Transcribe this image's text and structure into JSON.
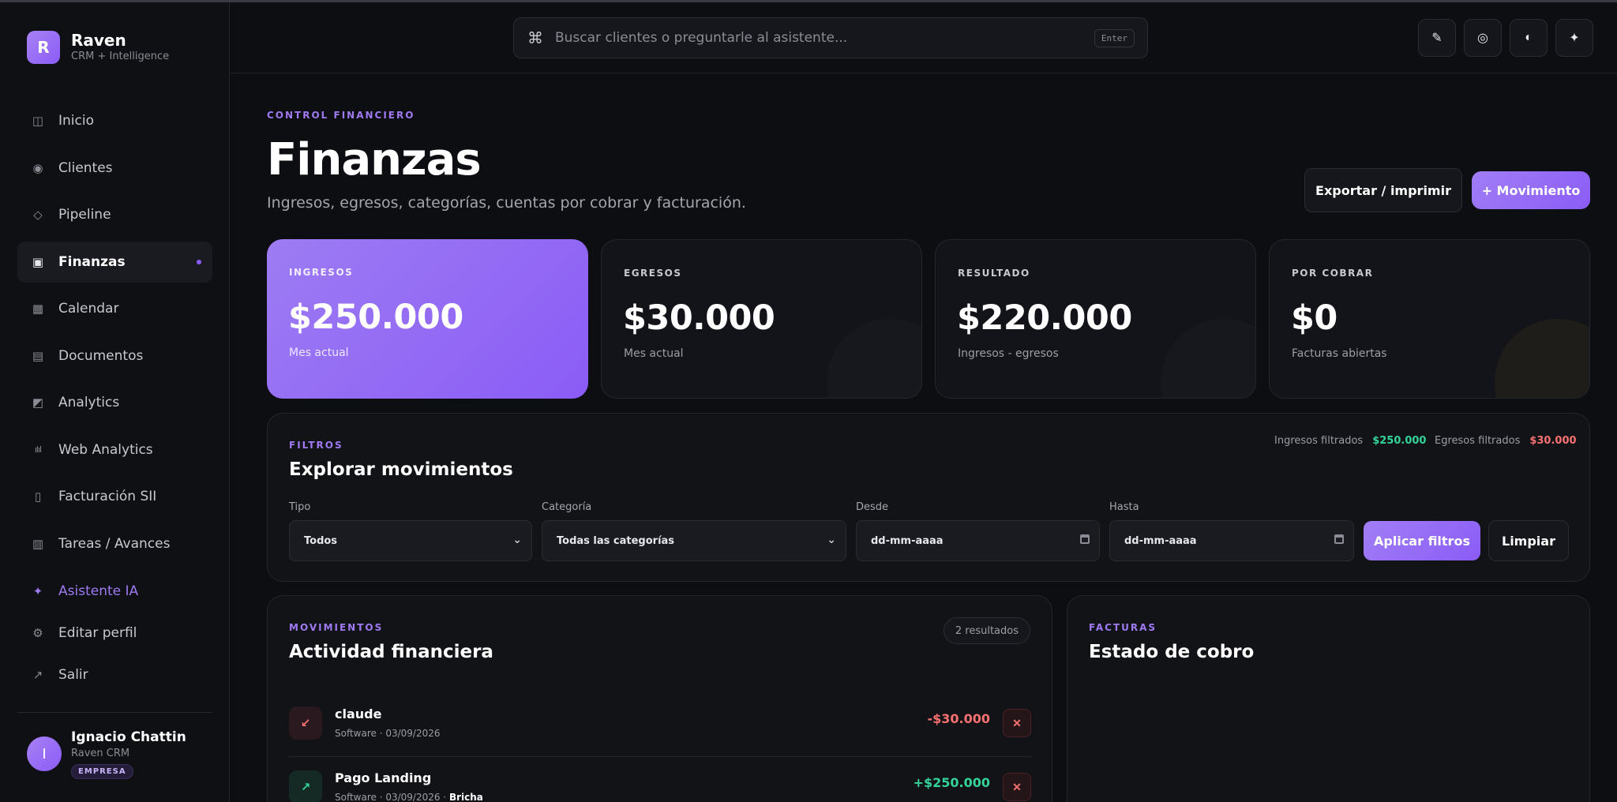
{
  "brand": {
    "initial": "R",
    "name": "Raven",
    "subtitle": "CRM + Intelligence"
  },
  "sidebar": {
    "items": [
      {
        "label": "Inicio",
        "icon": "columns-icon",
        "glyph": "◫"
      },
      {
        "label": "Clientes",
        "icon": "target-icon",
        "glyph": "◉"
      },
      {
        "label": "Pipeline",
        "icon": "diamond-icon",
        "glyph": "◇"
      },
      {
        "label": "Finanzas",
        "icon": "wallet-icon",
        "glyph": "▣",
        "active": true
      },
      {
        "label": "Calendar",
        "icon": "grid-icon",
        "glyph": "▦"
      },
      {
        "label": "Documentos",
        "icon": "stack-icon",
        "glyph": "▤"
      },
      {
        "label": "Analytics",
        "icon": "half-square-icon",
        "glyph": "◩"
      },
      {
        "label": "Web Analytics",
        "icon": "bar-chart-icon",
        "glyph": "ılıl"
      },
      {
        "label": "Facturación SII",
        "icon": "document-icon",
        "glyph": "▯"
      },
      {
        "label": "Tareas / Avances",
        "icon": "tasks-grid-icon",
        "glyph": "▥"
      }
    ],
    "secondary": [
      {
        "label": "Asistente IA",
        "icon": "sparkle-icon",
        "glyph": "✦"
      },
      {
        "label": "Editar perfil",
        "icon": "gear-icon",
        "glyph": "⚙"
      },
      {
        "label": "Salir",
        "icon": "exit-arrow-icon",
        "glyph": "↗"
      }
    ]
  },
  "user": {
    "initial": "I",
    "name": "Ignacio Chattin",
    "org": "Raven CRM",
    "badge": "EMPRESA"
  },
  "search": {
    "icon": "command-icon",
    "glyph": "⌘",
    "placeholder": "Buscar clientes o preguntarle al asistente...",
    "hint": "Enter"
  },
  "toolbar": [
    {
      "icon": "pencil-icon",
      "glyph": "✎"
    },
    {
      "icon": "ring-icon",
      "glyph": "◎"
    },
    {
      "icon": "contrast-icon",
      "glyph": "◐"
    },
    {
      "icon": "sparkle-icon",
      "glyph": "✦"
    }
  ],
  "page": {
    "eyebrow": "CONTROL FINANCIERO",
    "title": "Finanzas",
    "subtitle": "Ingresos, egresos, categorías, cuentas por cobrar y facturación.",
    "export_label": "Exportar / imprimir",
    "new_label": "+ Movimiento"
  },
  "kpis": [
    {
      "label": "INGRESOS",
      "value": "$250.000",
      "sub": "Mes actual"
    },
    {
      "label": "EGRESOS",
      "value": "$30.000",
      "sub": "Mes actual"
    },
    {
      "label": "RESULTADO",
      "value": "$220.000",
      "sub": "Ingresos - egresos"
    },
    {
      "label": "POR COBRAR",
      "value": "$0",
      "sub": "Facturas abiertas"
    }
  ],
  "filters": {
    "eyebrow": "FILTROS",
    "title": "Explorar movimientos",
    "income_label": "Ingresos filtrados",
    "income_value": "$250.000",
    "expense_label": "Egresos filtrados",
    "expense_value": "$30.000",
    "tipo_label": "Tipo",
    "tipo_value": "Todos",
    "categoria_label": "Categoría",
    "categoria_value": "Todas las categorías",
    "desde_label": "Desde",
    "desde_placeholder": "dd-mm-aaaa",
    "hasta_label": "Hasta",
    "hasta_placeholder": "dd-mm-aaaa",
    "apply_label": "Aplicar filtros",
    "clear_label": "Limpiar"
  },
  "movements": {
    "eyebrow": "MOVIMIENTOS",
    "title": "Actividad financiera",
    "count": "2 resultados",
    "rows": [
      {
        "name": "claude",
        "meta": "Software · 03/09/2026",
        "meta_extra": "",
        "amount": "-$30.000",
        "type": "out",
        "glyph": "↙"
      },
      {
        "name": "Pago Landing",
        "meta": "Software · 03/09/2026 · ",
        "meta_extra": "Bricha",
        "amount": "+$250.000",
        "type": "in",
        "glyph": "↗"
      }
    ],
    "delete_glyph": "✕"
  },
  "invoices": {
    "eyebrow": "FACTURAS",
    "title": "Estado de cobro"
  },
  "colors": {
    "accent": "#8b5cf6",
    "positive": "#34d399",
    "negative": "#f87171",
    "background": "#0d0e12"
  }
}
